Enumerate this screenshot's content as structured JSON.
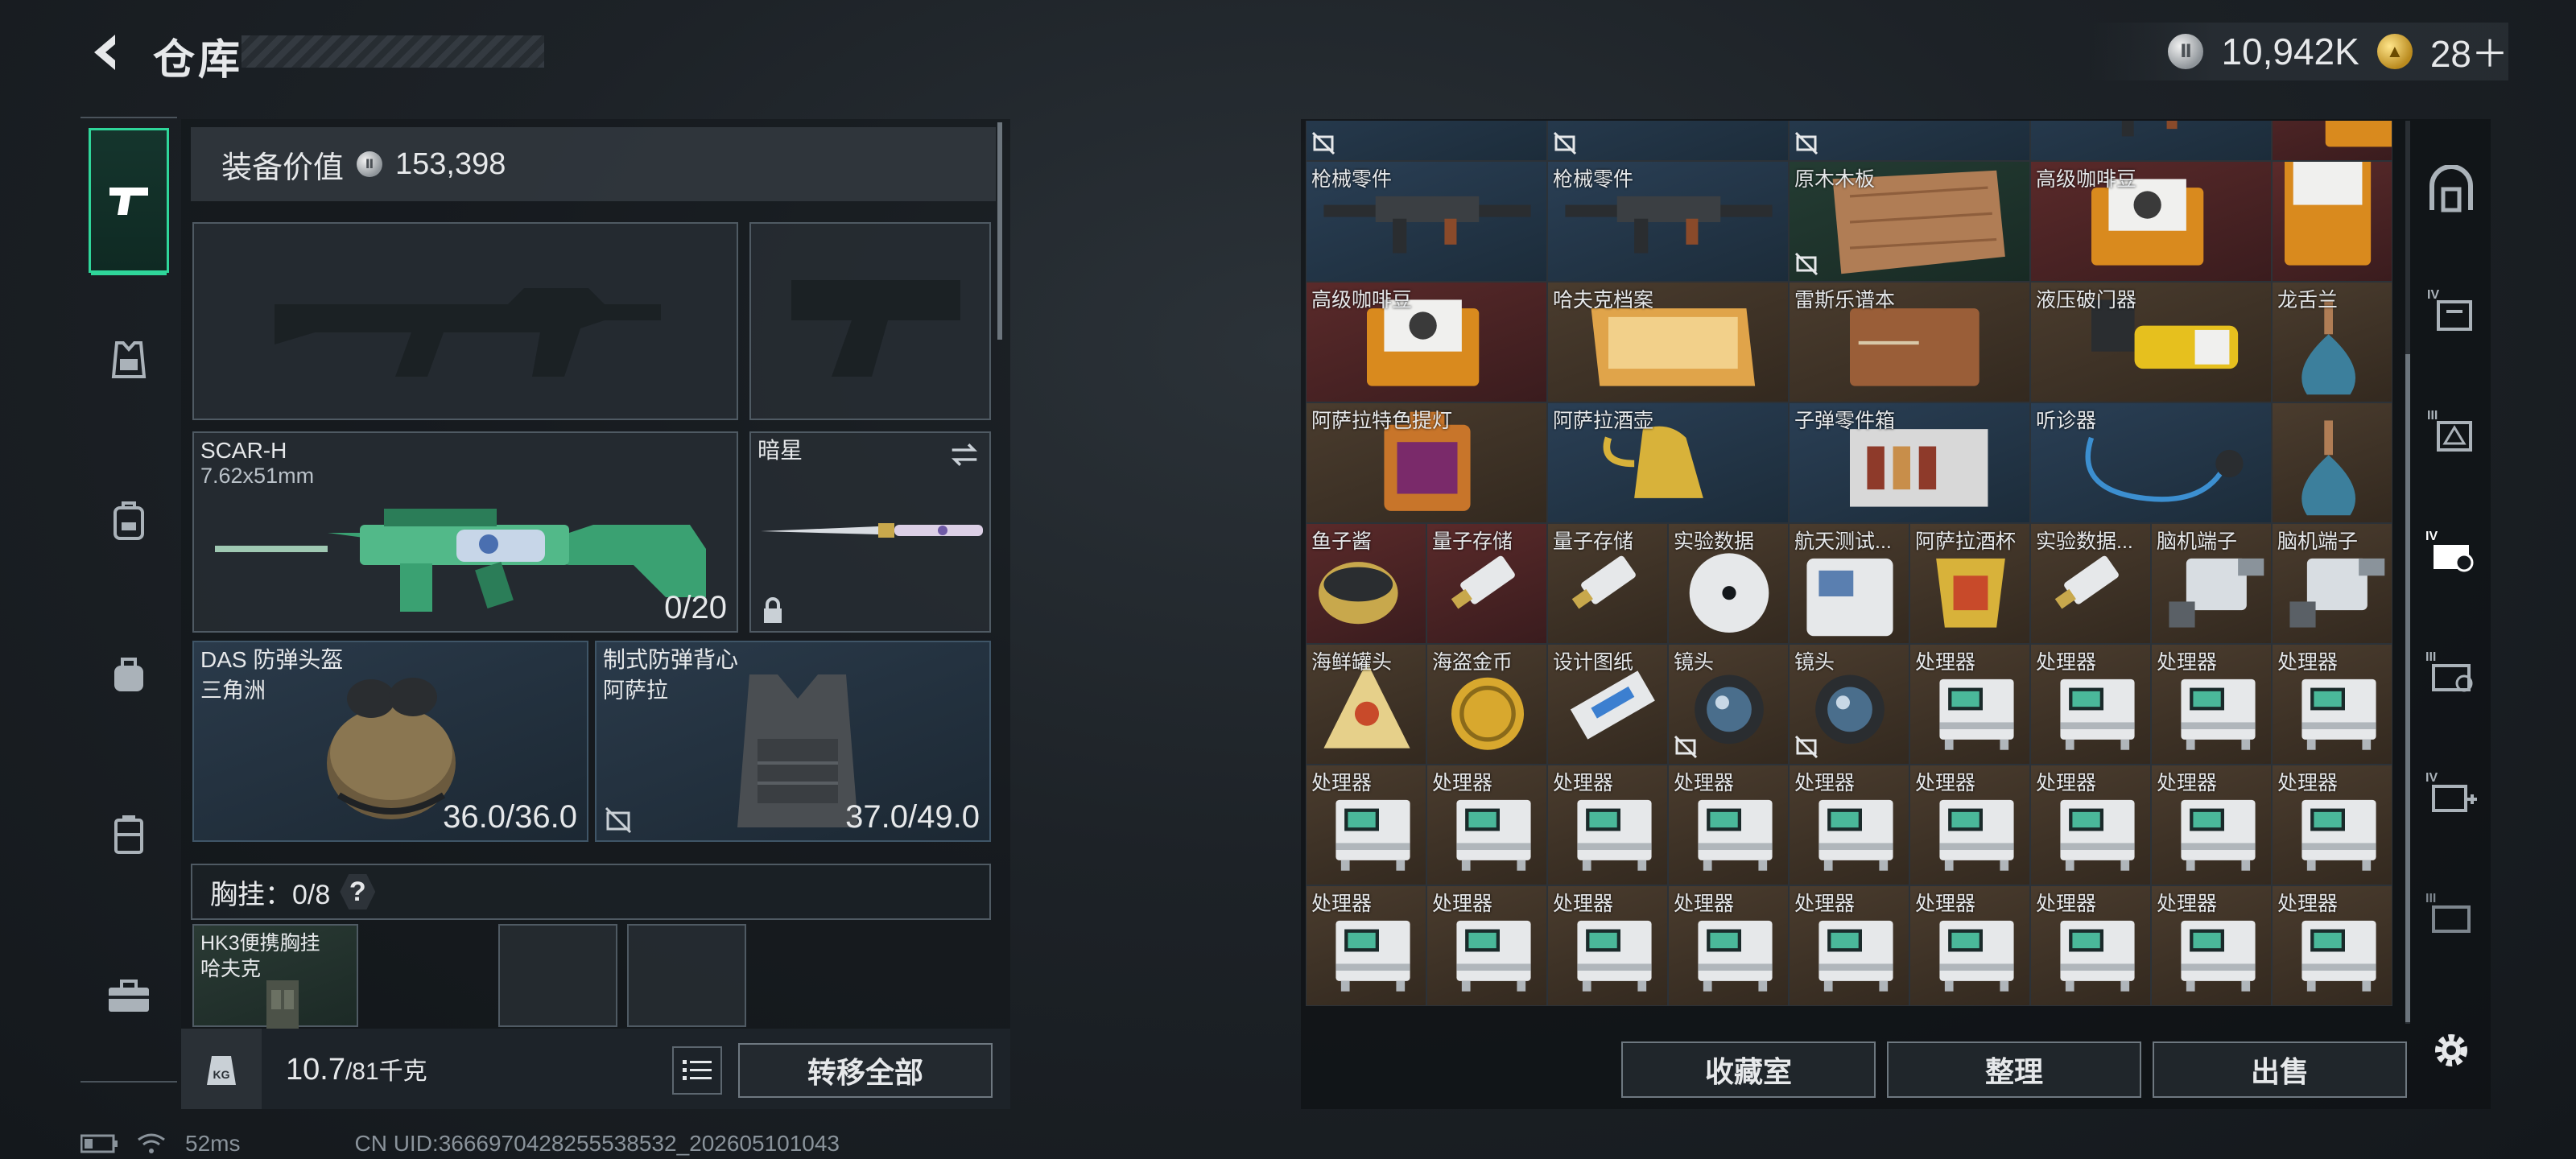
{
  "header": {
    "title": "仓库",
    "currency_silver": "10,942K",
    "currency_gold": "28＋"
  },
  "equipment": {
    "value_label": "装备价值",
    "value": "153,398",
    "primary_slot": {
      "name": "SCAR-H",
      "ammo": "7.62x51mm",
      "count": "0/20"
    },
    "melee_slot": {
      "name": "暗星"
    },
    "helmet": {
      "name": "DAS 防弹头盔",
      "sub": "三角洲",
      "durability": "36.0/36.0"
    },
    "armor": {
      "name": "制式防弹背心",
      "sub": "阿萨拉",
      "durability": "37.0/49.0"
    },
    "chest_label": "胸挂：0/8",
    "chest_help": "?",
    "chest_item": {
      "name": "HK3便携胸挂",
      "sub": "哈夫克"
    },
    "weight_value": "10.7",
    "weight_cap": "/81千克",
    "weight_icon": "KG",
    "transfer_all": "转移全部"
  },
  "stash": {
    "rows": [
      [
        "",
        "",
        "",
        "",
        ""
      ],
      [
        "枪械零件",
        "枪械零件",
        "原木木板",
        "高级咖啡豆",
        ""
      ],
      [
        "高级咖啡豆",
        "哈夫克档案",
        "雷斯乐谱本",
        "液压破门器",
        "龙舌兰"
      ],
      [
        "阿萨拉特色提灯",
        "阿萨拉酒壶",
        "子弹零件箱",
        "听诊器"
      ],
      [
        "鱼子酱",
        "量子存储",
        "量子存储",
        "实验数据",
        "航天测试...",
        "阿萨拉酒杯",
        "实验数据...",
        "脑机端子",
        "脑机端子"
      ],
      [
        "海鲜罐头",
        "海盗金币",
        "设计图纸",
        "镜头",
        "镜头",
        "处理器",
        "处理器",
        "处理器",
        "处理器"
      ],
      [
        "处理器",
        "处理器",
        "处理器",
        "处理器",
        "处理器",
        "处理器",
        "处理器",
        "处理器",
        "处理器"
      ],
      [
        "处理器",
        "处理器",
        "处理器",
        "处理器",
        "处理器",
        "处理器",
        "处理器",
        "处理器",
        "处理器"
      ]
    ]
  },
  "actions": {
    "collection": "收藏室",
    "sort": "整理",
    "sell": "出售"
  },
  "status": {
    "ping": "52ms",
    "uid": "CN UID:3666970428255538532_202605101043"
  },
  "colors": {
    "accent": "#2fd69a",
    "rare_blue": "#2a3f55",
    "rare_red": "#5a2a2a",
    "common_brown": "#4a3c2e"
  }
}
